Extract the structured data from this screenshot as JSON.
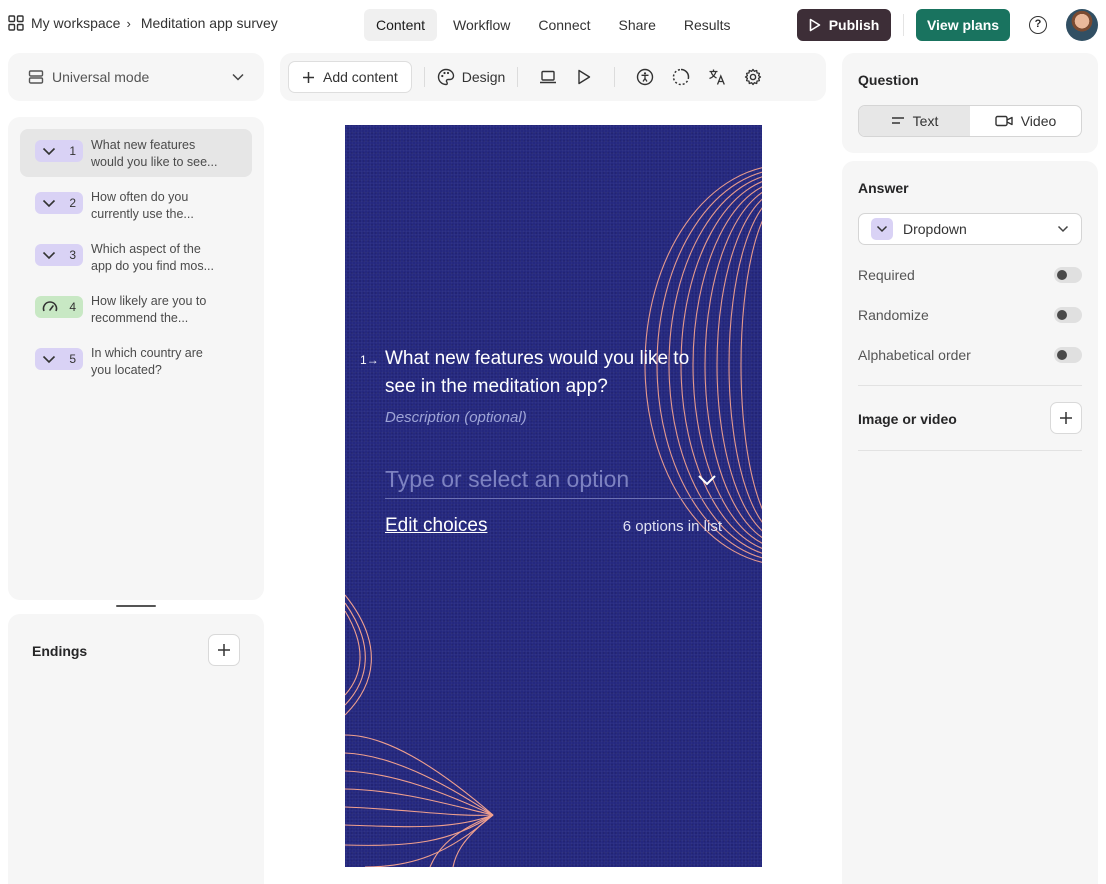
{
  "header": {
    "workspace": "My workspace",
    "survey_title": "Meditation app survey",
    "tabs": [
      {
        "label": "Content"
      },
      {
        "label": "Workflow"
      },
      {
        "label": "Connect"
      },
      {
        "label": "Share"
      },
      {
        "label": "Results"
      }
    ],
    "active_tab": "Content",
    "publish_label": "Publish",
    "view_plans_label": "View plans",
    "help_glyph": "?"
  },
  "sidebar": {
    "mode_label": "Universal mode",
    "questions": [
      {
        "number": "1",
        "line1": "What new features",
        "line2": "would you like to see...",
        "type_icon": "chevron-down-icon",
        "color": "purple"
      },
      {
        "number": "2",
        "line1": "How often do you",
        "line2": "currently use the...",
        "type_icon": "chevron-down-icon",
        "color": "purple"
      },
      {
        "number": "3",
        "line1": "Which aspect of the",
        "line2": "app do you find mos...",
        "type_icon": "chevron-down-icon",
        "color": "purple"
      },
      {
        "number": "4",
        "line1": "How likely are you to",
        "line2": "recommend the...",
        "type_icon": "gauge-icon",
        "color": "green"
      },
      {
        "number": "5",
        "line1": "In which country are",
        "line2": "you located?",
        "type_icon": "chevron-down-icon",
        "color": "purple"
      }
    ],
    "endings_label": "Endings"
  },
  "toolbar": {
    "add_content_label": "Add content",
    "design_label": "Design"
  },
  "preview": {
    "question_number": "1",
    "question_title": "What new features would you like to see in the meditation app?",
    "description_placeholder": "Description (optional)",
    "dropdown_placeholder": "Type or select an option",
    "edit_choices_label": "Edit choices",
    "options_count_text": "6 options in list",
    "colors": {
      "background": "#25287f",
      "accent_lines": "#f0a08e",
      "text": "#ffffff"
    }
  },
  "right_panel": {
    "question_section": "Question",
    "question_format": [
      {
        "label": "Text",
        "icon": "text-lines-icon"
      },
      {
        "label": "Video",
        "icon": "video-icon"
      }
    ],
    "active_format": "Text",
    "answer_section": "Answer",
    "answer_type": "Dropdown",
    "toggles": [
      {
        "label": "Required",
        "on": false
      },
      {
        "label": "Randomize",
        "on": false
      },
      {
        "label": "Alphabetical order",
        "on": false
      }
    ],
    "image_or_video_label": "Image or video"
  },
  "colors": {
    "publish": "#3d2e37",
    "view_plans": "#19735f",
    "dropdown_badge": "#d9d2f5",
    "opinion_scale_badge": "#c8e8c4"
  }
}
